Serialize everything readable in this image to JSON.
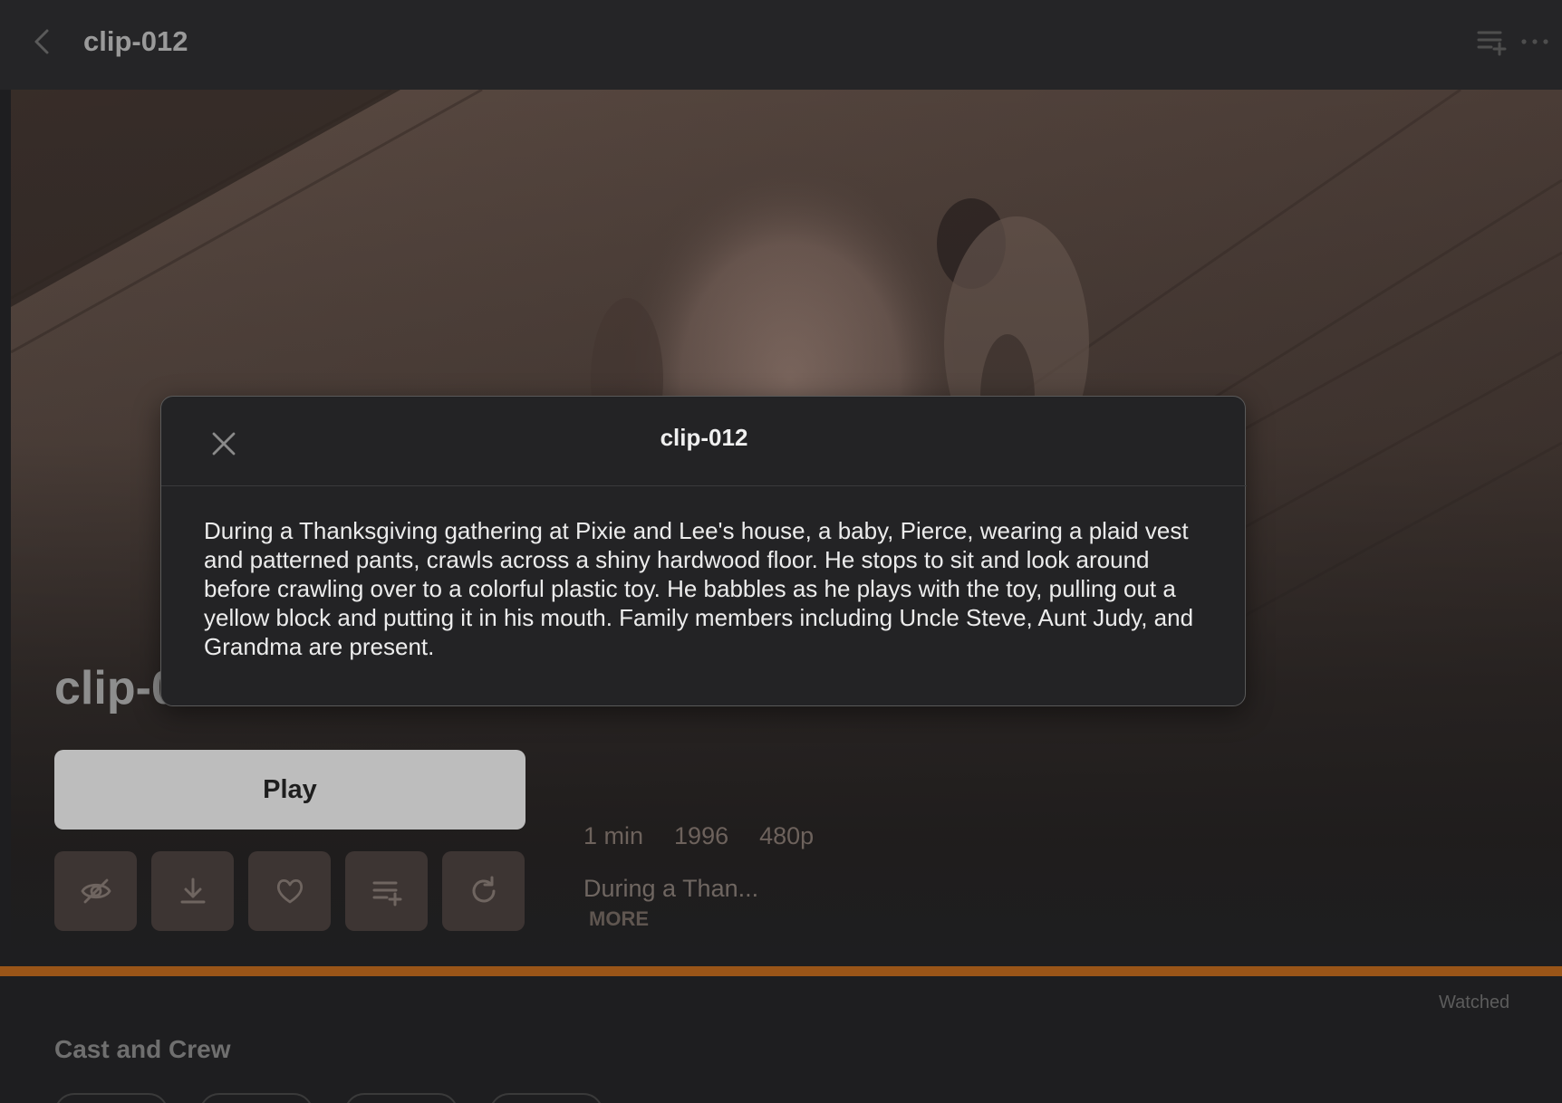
{
  "header": {
    "title": "clip-012",
    "back_icon": "chevron-left-icon",
    "queue_icon": "add-to-queue-icon",
    "more_icon": "more-horizontal-icon"
  },
  "hero": {
    "title": "clip-012",
    "play_label": "Play",
    "actions": [
      {
        "name": "mark-watched-button",
        "icon": "eye-slash-icon"
      },
      {
        "name": "download-button",
        "icon": "download-icon"
      },
      {
        "name": "favorite-button",
        "icon": "heart-icon"
      },
      {
        "name": "add-to-playlist-button",
        "icon": "playlist-add-icon"
      },
      {
        "name": "refresh-button",
        "icon": "refresh-icon"
      }
    ],
    "meta": {
      "duration": "1 min",
      "year": "1996",
      "resolution": "480p"
    },
    "short_description": "During a Than...",
    "more_label": "MORE"
  },
  "progress": {
    "fraction": 1.0,
    "color": "#8a4b12"
  },
  "watched_label": "Watched",
  "cast_section_title": "Cast and Crew",
  "modal": {
    "title": "clip-012",
    "close_icon": "close-icon",
    "description": "During a Thanksgiving gathering at Pixie and Lee's house, a baby, Pierce, wearing a plaid vest and patterned pants, crawls across a shiny hardwood floor. He stops to sit and look around before crawling over to a colorful plastic toy. He babbles as he plays with the toy, pulling out a yellow block and putting it in his mouth. Family members including Uncle Steve, Aunt Judy, and Grandma are present."
  },
  "colors": {
    "accent": "#8a4b12",
    "background": "#1e1e20"
  }
}
